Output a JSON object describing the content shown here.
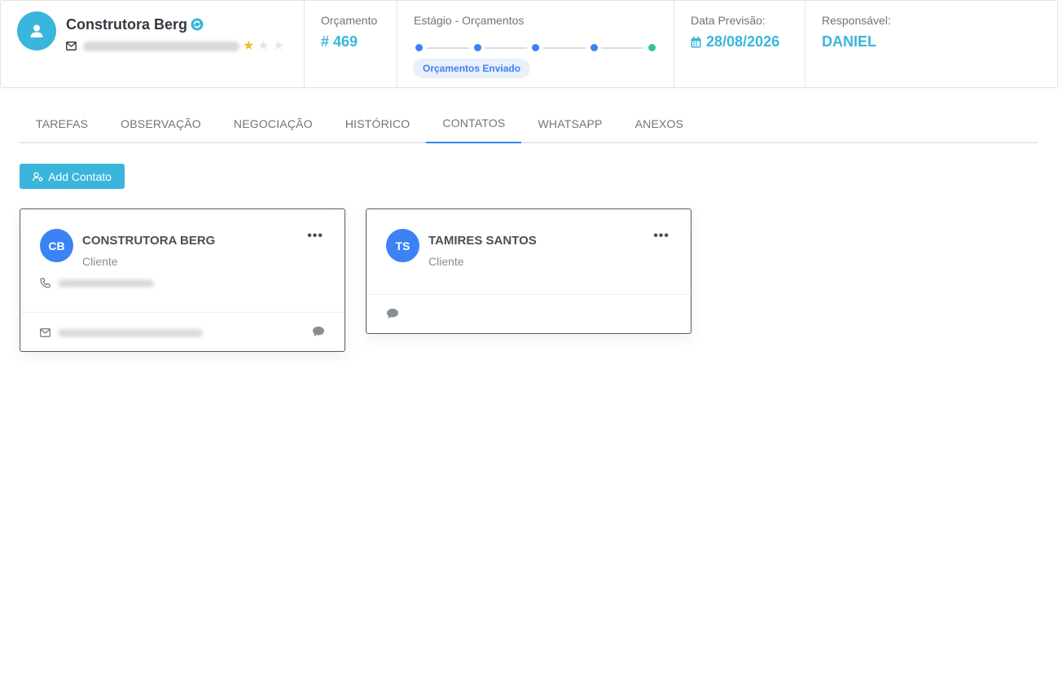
{
  "header": {
    "client_name": "Construtora Berg",
    "rating": 1,
    "rating_max": 3,
    "orcamento_label": "Orçamento",
    "orcamento_value": "# 469",
    "stage_label": "Estágio - Orçamentos",
    "stage_badge": "Orçamentos Enviado",
    "date_label": "Data Previsão:",
    "date_value": "28/08/2026",
    "resp_label": "Responsável:",
    "resp_value": "DANIEL"
  },
  "tabs": [
    {
      "label": "TAREFAS"
    },
    {
      "label": "OBSERVAÇÃO"
    },
    {
      "label": "NEGOCIAÇÃO"
    },
    {
      "label": "HISTÓRICO"
    },
    {
      "label": "CONTATOS"
    },
    {
      "label": "WHATSAPP"
    },
    {
      "label": "ANEXOS"
    }
  ],
  "active_tab": "CONTATOS",
  "add_button_label": "Add Contato",
  "contacts": [
    {
      "initials": "CB",
      "name": "CONSTRUTORA BERG",
      "role": "Cliente",
      "menu": "•••"
    },
    {
      "initials": "TS",
      "name": "TAMIRES SANTOS",
      "role": "Cliente",
      "menu": "•••"
    }
  ],
  "colors": {
    "accent": "#3ab5dc",
    "primary": "#3b82f6",
    "success": "#34c38f",
    "star": "#f6bc25"
  },
  "icons": [
    "user-icon",
    "sync-icon",
    "envelope-icon",
    "star-icon",
    "calendar-icon",
    "user-gear-icon",
    "phone-icon",
    "comment-icon",
    "more-icon"
  ]
}
